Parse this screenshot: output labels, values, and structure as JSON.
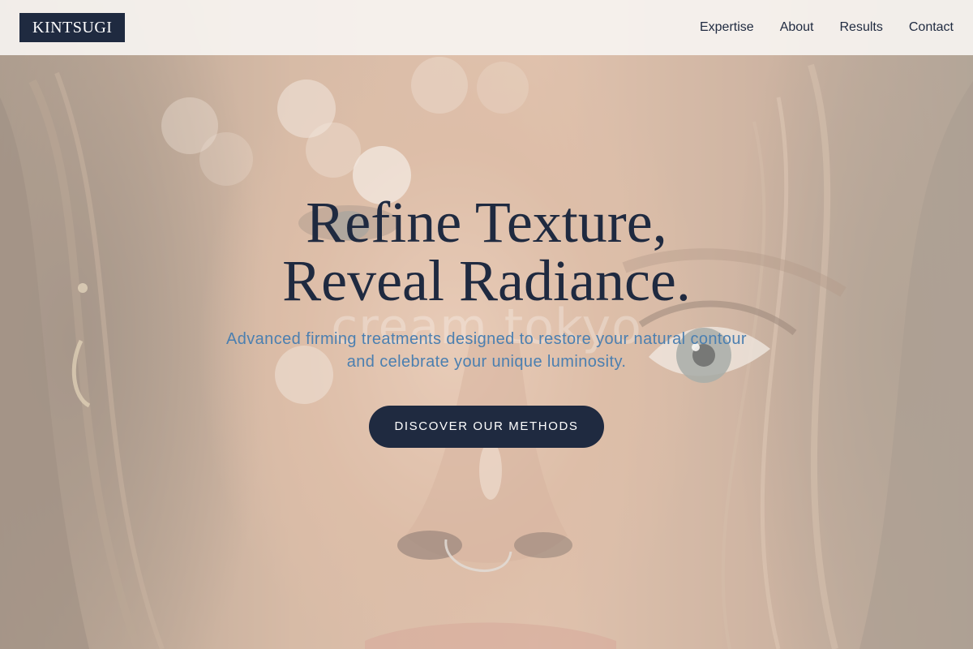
{
  "header": {
    "logo": "KINTSUGI",
    "nav": [
      {
        "label": "Expertise"
      },
      {
        "label": "About"
      },
      {
        "label": "Results"
      },
      {
        "label": "Contact"
      }
    ]
  },
  "hero": {
    "title_line1": "Refine Texture,",
    "title_line2": "Reveal Radiance.",
    "subtitle_line1": "Advanced firming treatments designed to restore your natural contour",
    "subtitle_line2": "and celebrate your unique luminosity.",
    "cta_label": "DISCOVER OUR METHODS",
    "watermark": "cream tokyo",
    "background_image": "close-up portrait of a woman with freckles and a nose ring, bokeh highlights"
  },
  "colors": {
    "navy": "#1f2a40",
    "subtitle_blue": "#4b7fb0",
    "header_bg": "#f6f3f0"
  }
}
